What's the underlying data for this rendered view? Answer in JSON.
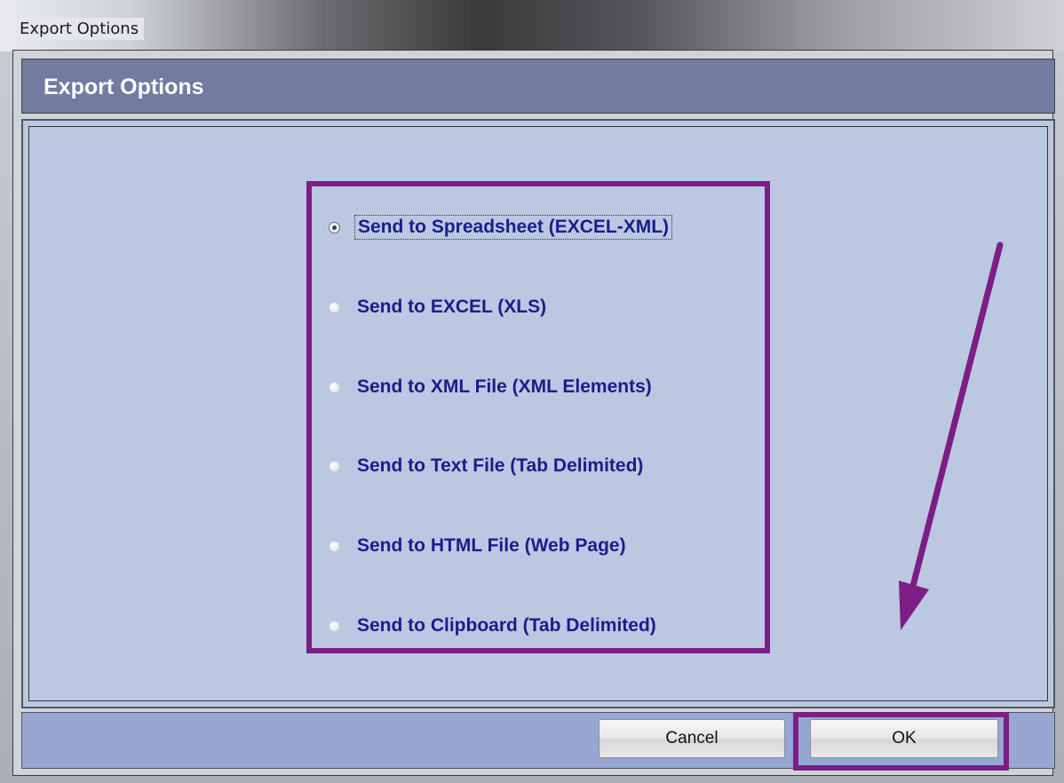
{
  "window": {
    "title": "Export Options"
  },
  "header": {
    "title": "Export Options"
  },
  "options": [
    {
      "label": "Send to Spreadsheet (EXCEL-XML)",
      "selected": true
    },
    {
      "label": "Send to EXCEL (XLS)",
      "selected": false
    },
    {
      "label": "Send to XML File (XML Elements)",
      "selected": false
    },
    {
      "label": "Send to Text File (Tab Delimited)",
      "selected": false
    },
    {
      "label": "Send to HTML File (Web Page)",
      "selected": false
    },
    {
      "label": "Send to Clipboard (Tab Delimited)",
      "selected": false
    }
  ],
  "buttons": {
    "cancel": "Cancel",
    "ok": "OK"
  },
  "colors": {
    "highlight": "#7d1d86",
    "header_bg": "#737ba0",
    "content_bg": "#bcc8e2",
    "option_text": "#1c1c8c"
  }
}
